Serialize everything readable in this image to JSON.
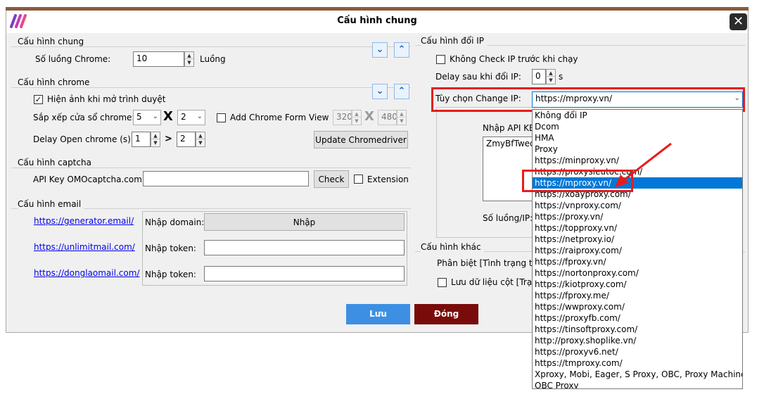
{
  "window": {
    "title": "Cấu hình chung",
    "close_label": "✕"
  },
  "general": {
    "title": "Cấu hình chung",
    "threads_label": "Số luồng Chrome:",
    "threads_value": "10",
    "threads_unit": "Luồng"
  },
  "chrome": {
    "title": "Cấu hình chrome",
    "show_image_label": "Hiện ảnh khi mở trình duyệt",
    "arrange_label": "Sắp xếp cửa sổ chrome:",
    "cols_value": "5",
    "times_symbol": "X",
    "rows_value": "2",
    "add_form_label": "Add Chrome Form View",
    "form_width": "320",
    "form_height": "480",
    "delay_label": "Delay Open chrome (s):",
    "delay_min": "1",
    "gt_symbol": ">",
    "delay_max": "2",
    "update_button": "Update Chromedriver"
  },
  "captcha": {
    "title": "Cấu hình captcha",
    "api_label": "API Key OMOcaptcha.com:",
    "api_value": "",
    "check_button": "Check",
    "extension_label": "Extension"
  },
  "email": {
    "title": "Cấu hình email",
    "rows": [
      {
        "link": "https://generator.email/",
        "label": "Nhập domain:",
        "value": "Nhập"
      },
      {
        "link": "https://unlimitmail.com/",
        "label": "Nhập token:",
        "value": ""
      },
      {
        "link": "https://donglaomail.com/",
        "label": "Nhập token:",
        "value": ""
      }
    ]
  },
  "ip": {
    "title": "Cấu hình đổi IP",
    "no_check_label": "Không Check IP trước khi chạy",
    "delay_label": "Delay sau khi đổi IP:",
    "delay_value": "0",
    "delay_unit": "s",
    "change_label": "Tùy chọn Change IP:",
    "change_value": "https://mproxy.vn/",
    "api_key_label": "Nhập API KE",
    "api_key_value": "ZmyBfTweq",
    "threads_label": "Số luồng/IP:"
  },
  "other": {
    "title": "Cấu hình khác",
    "distinguish_label": "Phân biệt [Tình trạng tà",
    "save_column_label": "Lưu dữ liệu cột [Trạ"
  },
  "buttons": {
    "save": "Lưu",
    "close": "Đóng"
  },
  "dropdown": {
    "selected_index": 6,
    "options": [
      "Không đổi IP",
      "Dcom",
      "HMA",
      "Proxy",
      "https://minproxy.vn/",
      "https://proxysieutoc.com/",
      "https://mproxy.vn/",
      "https://xoayproxy.com/",
      "https://vnproxy.com/",
      "https://proxy.vn/",
      "https://topproxy.vn/",
      "https://netproxy.io/",
      "https://raiproxy.com/",
      "https://fproxy.vn/",
      "https://nortonproxy.com/",
      "https://kiotproxy.com/",
      "https://fproxy.me/",
      "https://wwproxy.com/",
      "https://proxyfb.com/",
      "https://tinsoftproxy.com/",
      "http://proxy.shoplike.vn/",
      "https://proxyv6.net/",
      "https://tmproxy.com/",
      "Xproxy, Mobi, Eager, S Proxy, OBC, Proxy Machine",
      "OBC Proxy"
    ]
  },
  "colors": {
    "highlight": "#e81c1c",
    "save_button": "#3d8fe3",
    "close_button": "#7a0b0b",
    "accent": "#0078d7"
  }
}
